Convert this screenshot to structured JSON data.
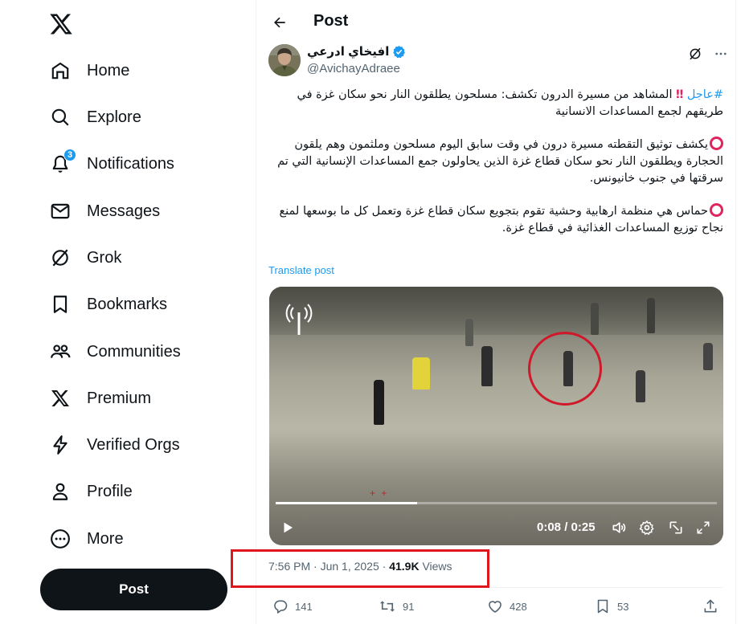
{
  "nav": {
    "items": [
      {
        "key": "home",
        "label": "Home",
        "icon": "home-icon"
      },
      {
        "key": "explore",
        "label": "Explore",
        "icon": "search-icon"
      },
      {
        "key": "notifications",
        "label": "Notifications",
        "icon": "bell-icon",
        "badge": "3"
      },
      {
        "key": "messages",
        "label": "Messages",
        "icon": "envelope-icon"
      },
      {
        "key": "grok",
        "label": "Grok",
        "icon": "grok-icon"
      },
      {
        "key": "bookmarks",
        "label": "Bookmarks",
        "icon": "bookmark-icon"
      },
      {
        "key": "communities",
        "label": "Communities",
        "icon": "people-icon"
      },
      {
        "key": "premium",
        "label": "Premium",
        "icon": "x-logo-icon"
      },
      {
        "key": "verified_orgs",
        "label": "Verified Orgs",
        "icon": "lightning-icon"
      },
      {
        "key": "profile",
        "label": "Profile",
        "icon": "person-icon"
      },
      {
        "key": "more",
        "label": "More",
        "icon": "more-circle-icon"
      }
    ],
    "post_button": "Post"
  },
  "header": {
    "title": "Post"
  },
  "tweet": {
    "author_name": "افيخاي ادرعي",
    "handle": "@AvichayAdraee",
    "hashtag": "#عاجل",
    "line1": "المشاهد من مسيرة الدرون تكشف: مسلحون يطلقون النار نحو سكان غزة في طريقهم لجمع المساعدات الانسانية",
    "para2": "يكشف توثيق التقطته مسيرة درون في وقت سابق اليوم مسلحون وملثمون وهم يلقون الحجارة ويطلقون النار نحو سكان قطاع غزة الذين يحاولون جمع المساعدات الإنسانية التي تم سرقتها في جنوب خانيونس.",
    "para3": "حماس هي منظمة ارهابية وحشية تقوم بتجويع سكان قطاع غزة وتعمل كل ما بوسعها لمنع نجاح توزيع المساعدات الغذائية في قطاع غزة.",
    "translate": "Translate post",
    "video": {
      "time": "0:08 / 0:25",
      "progress": 0.32
    },
    "timestamp": "7:56 PM · Jun 1, 2025 · ",
    "views_count": "41.9K",
    "views_label": " Views",
    "stats": {
      "replies": "141",
      "reposts": "91",
      "likes": "428",
      "bookmarks": "53"
    }
  },
  "colors": {
    "accent": "#1d9bf0",
    "highlight_box": "#e0151f",
    "text": "#0f1419",
    "muted": "#536471"
  }
}
